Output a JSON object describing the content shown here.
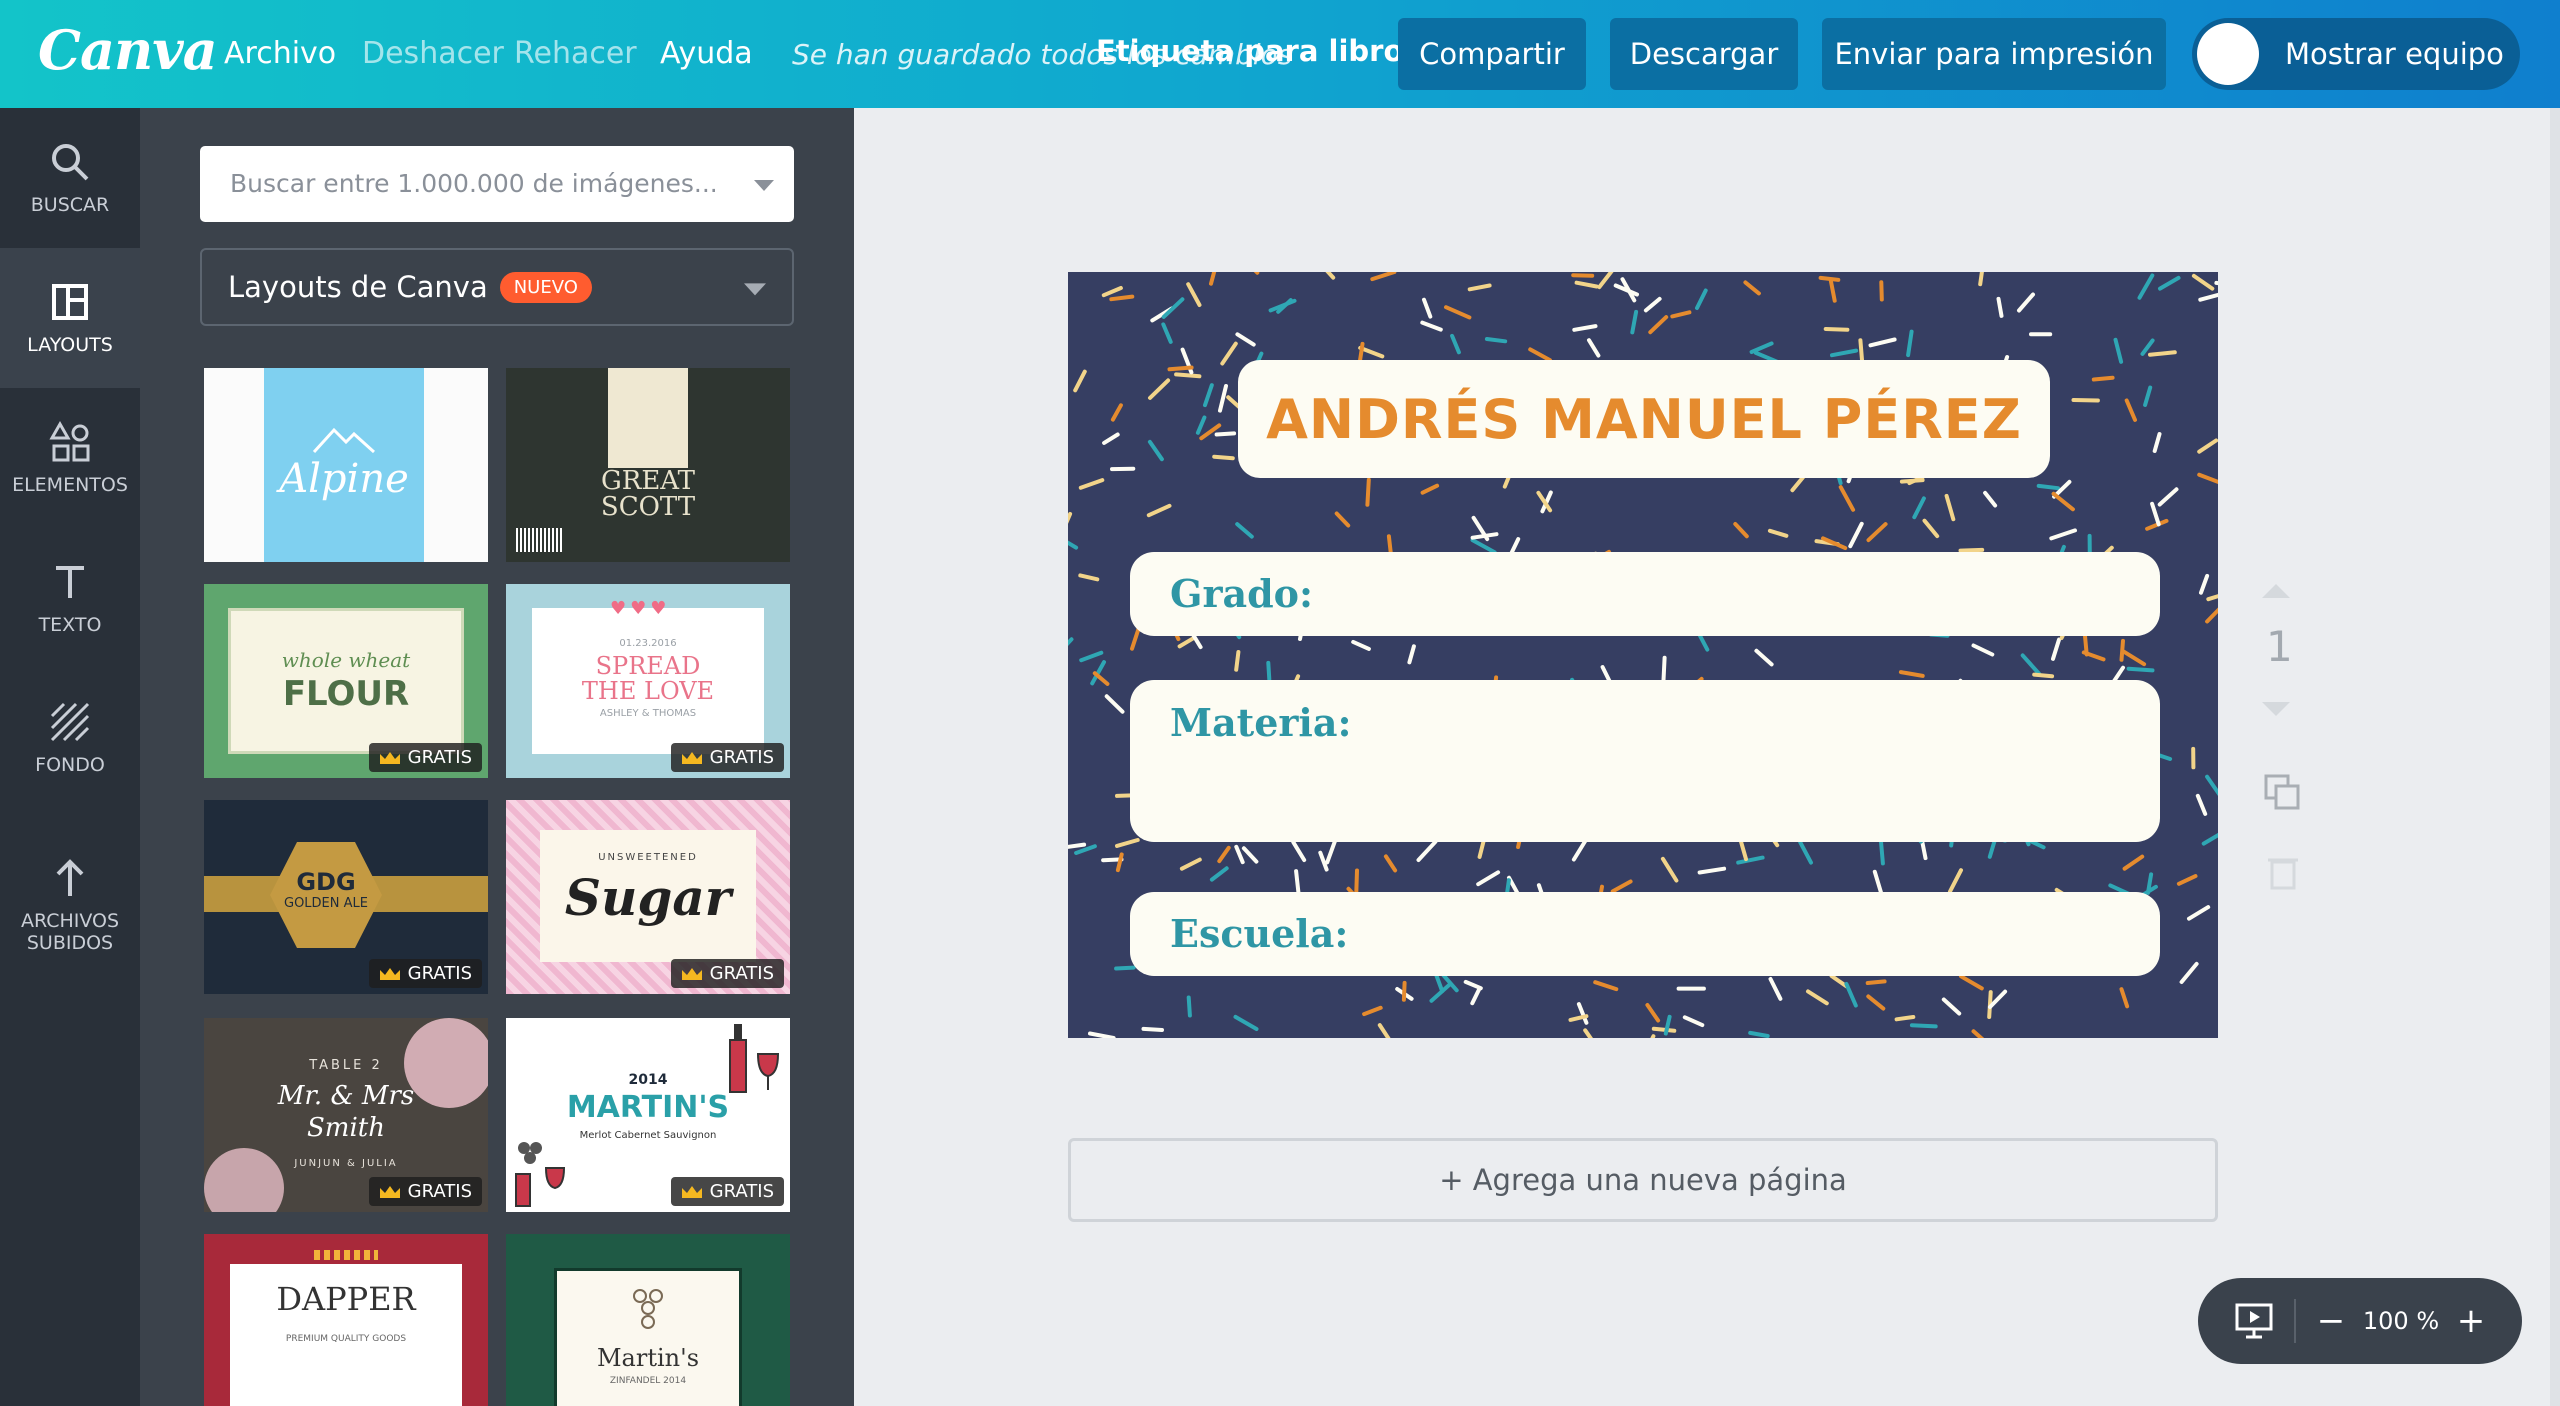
{
  "app": {
    "logo": "Canva"
  },
  "menu": {
    "archivo": "Archivo",
    "deshacer": "Deshacer",
    "rehacer": "Rehacer",
    "ayuda": "Ayuda"
  },
  "status": {
    "saved": "Se han guardado todos los cambios"
  },
  "document": {
    "title": "Etiqueta para libros"
  },
  "top_buttons": {
    "share": "Compartir",
    "download": "Descargar",
    "print": "Enviar para impresión",
    "team": "Mostrar equipo"
  },
  "nav": {
    "buscar": "BUSCAR",
    "layouts": "LAYOUTS",
    "elementos": "ELEMENTOS",
    "texto": "TEXTO",
    "fondo": "FONDO",
    "archivos_1": "ARCHIVOS",
    "archivos_2": "SUBIDOS"
  },
  "panel": {
    "search_placeholder": "Buscar entre 1.000.000 de imágenes...",
    "dropdown_label": "Layouts de Canva",
    "new_badge": "NUEVO",
    "free_label": "GRATIS"
  },
  "templates": {
    "alpine": "Alpine",
    "great_scott_1": "GREAT",
    "great_scott_2": "SCOTT",
    "flour_top": "whole wheat",
    "flour_main": "FLOUR",
    "spread_date": "01.23.2016",
    "spread_1": "SPREAD",
    "spread_2": "THE LOVE",
    "spread_names": "ASHLEY & THOMAS",
    "gdg_1": "GDG",
    "gdg_2": "GOLDEN ALE",
    "sugar_top": "UNSWEETENED",
    "sugar_main": "Sugar",
    "table_top": "TABLE 2",
    "table_1": "Mr. & Mrs",
    "table_2": "Smith",
    "table_names": "JUNJUN & JULIA",
    "martins_year": "2014",
    "martins_main": "MARTIN'S",
    "martins_sub": "Merlot Cabernet Sauvignon",
    "dapper": "DAPPER",
    "dapper_sub": "PREMIUM QUALITY GOODS",
    "martins2": "Martin's",
    "martins2_sub": "ZINFANDEL 2014"
  },
  "design": {
    "name": "ANDRÉS MANUEL PÉREZ",
    "field_grado": "Grado:",
    "field_materia": "Materia:",
    "field_escuela": "Escuela:"
  },
  "canvas": {
    "page_number": "1",
    "add_page": "+ Agrega una nueva página"
  },
  "zoom": {
    "level": "100 %",
    "minus": "−",
    "plus": "+"
  },
  "colors": {
    "accent": "#13c4c9",
    "design_bg": "#363e62",
    "name_text": "#e58b2e",
    "field_text": "#2f96a5"
  }
}
